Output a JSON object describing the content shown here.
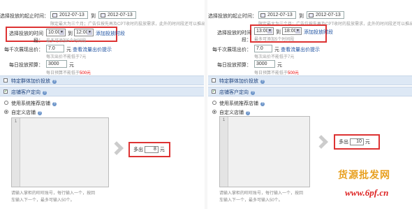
{
  "left": {
    "start_end_label": "选择投放的起止时间：",
    "start_date": "2012-07-13",
    "to": "到",
    "end_date": "2012-07-13",
    "date_hint": "限定最大为三个月；广告位按先再及CPT收时的投放需求，此外的时间段还可以推出",
    "time_label": "选择投放的时间段：",
    "time_start": "10:00",
    "time_end": "12:00",
    "add_time_link": "添加投放时段",
    "time_hint": "最多可添加5个时间段",
    "click_price_label": "每千次展现出价：",
    "click_price_value": "7.0",
    "unit_yuan": "元",
    "view_traffic_link": "查看流量出价提示",
    "click_price_hint": "每次出价不能低于7元",
    "daily_budget_label": "每日投放预算：",
    "daily_budget_value": "3000",
    "daily_budget_hint_prefix": "每日预算不能低于",
    "daily_budget_hint_value": "500元",
    "bar1": "特定群体加价投放",
    "bar2": "店铺客户定向",
    "radio1": "使用系统推荐店铺",
    "radio2": "自定义店铺",
    "editor_line": "1",
    "editor_hint_line1": "请输入掌柜的旺旺账号，每行输入一个，按回",
    "editor_hint_line2": "车输入下一个，最多可输入50个。",
    "bid_prefix": "多出",
    "bid_value": "8",
    "bid_suffix": "元"
  },
  "right": {
    "start_end_label": "选择投放的起止时间：",
    "start_date": "2012-07-13",
    "to": "到",
    "end_date": "2012-07-13",
    "date_hint": "限定最大为三个月；广告位按先再及CPT收时的投放需求，此外的时间段还可以推出",
    "time_label": "选择投放的时间段：",
    "time_start": "13:00",
    "time_end": "18:00",
    "add_time_link": "添加投放时段",
    "time_hint": "最多可添加5个时间段",
    "click_price_label": "每千次展现出价：",
    "click_price_value": "7.0",
    "unit_yuan": "元",
    "view_traffic_link": "查看流量出价提示",
    "click_price_hint": "每次出价不能低于7元",
    "daily_budget_label": "每日投放预算：",
    "daily_budget_value": "3000",
    "daily_budget_hint_prefix": "每日预算不能低于",
    "daily_budget_hint_value": "500元",
    "bar1": "特定群体加价投放",
    "bar2": "店铺客户定向",
    "radio1": "使用系统推荐店铺",
    "radio2": "自定义店铺",
    "editor_line": "1",
    "editor_hint_line1": "请输入掌柜的旺旺账号，每行输入一个，按回",
    "editor_hint_line2": "车输入下一个，最多可输入50个。",
    "bid_prefix": "多出",
    "bid_value": "10",
    "bid_suffix": "元"
  },
  "watermark": {
    "line1": "货源批发网",
    "line2": "www.6pf.cn"
  },
  "colors": {
    "highlight_box": "#dd3333",
    "section_bar": "#dde8f5",
    "link": "#1a4fa0",
    "watermark_orange": "#e8a020",
    "watermark_red": "#dd2222"
  }
}
